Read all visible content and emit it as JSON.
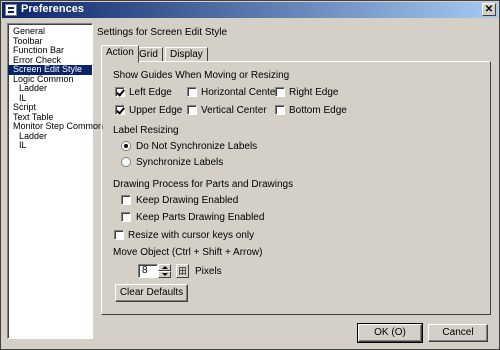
{
  "window": {
    "title": "Preferences",
    "close_glyph": "✕"
  },
  "tree": {
    "items": [
      {
        "label": "General",
        "level": 0,
        "selected": false
      },
      {
        "label": "Toolbar",
        "level": 0,
        "selected": false
      },
      {
        "label": "Function Bar",
        "level": 0,
        "selected": false
      },
      {
        "label": "Error Check",
        "level": 0,
        "selected": false
      },
      {
        "label": "Screen Edit Style",
        "level": 0,
        "selected": true
      },
      {
        "label": "Logic Common",
        "level": 0,
        "selected": false
      },
      {
        "label": "Ladder",
        "level": 1,
        "selected": false
      },
      {
        "label": "IL",
        "level": 1,
        "selected": false
      },
      {
        "label": "Script",
        "level": 0,
        "selected": false
      },
      {
        "label": "Text Table",
        "level": 0,
        "selected": false
      },
      {
        "label": "Monitor Step Common",
        "level": 0,
        "selected": false
      },
      {
        "label": "Ladder",
        "level": 1,
        "selected": false
      },
      {
        "label": "IL",
        "level": 1,
        "selected": false
      }
    ]
  },
  "panel": {
    "title": "Settings for Screen Edit Style",
    "tabs": [
      {
        "label": "Action",
        "active": true
      },
      {
        "label": "Grid",
        "active": false
      },
      {
        "label": "Display",
        "active": false
      }
    ],
    "guides": {
      "label": "Show Guides When Moving or Resizing",
      "left_edge": {
        "label": "Left Edge",
        "checked": true
      },
      "horizontal_center": {
        "label": "Horizontal Center",
        "checked": false
      },
      "right_edge": {
        "label": "Right Edge",
        "checked": false
      },
      "upper_edge": {
        "label": "Upper Edge",
        "checked": true
      },
      "vertical_center": {
        "label": "Vertical Center",
        "checked": false
      },
      "bottom_edge": {
        "label": "Bottom Edge",
        "checked": false
      }
    },
    "label_resizing": {
      "label": "Label Resizing",
      "do_not_sync": {
        "label": "Do Not Synchronize Labels",
        "selected": true
      },
      "sync": {
        "label": "Synchronize Labels",
        "selected": false
      }
    },
    "drawing_process": {
      "label": "Drawing Process for Parts and Drawings",
      "keep_drawing": {
        "label": "Keep Drawing Enabled",
        "checked": false
      },
      "keep_parts": {
        "label": "Keep Parts Drawing Enabled",
        "checked": false
      }
    },
    "resize_cursor": {
      "label": "Resize with cursor keys only",
      "checked": false
    },
    "move_object": {
      "label": "Move Object (Ctrl + Shift + Arrow)",
      "value": "8",
      "unit": "Pixels"
    },
    "clear_defaults": "Clear Defaults"
  },
  "footer": {
    "ok": "OK (O)",
    "cancel": "Cancel"
  }
}
